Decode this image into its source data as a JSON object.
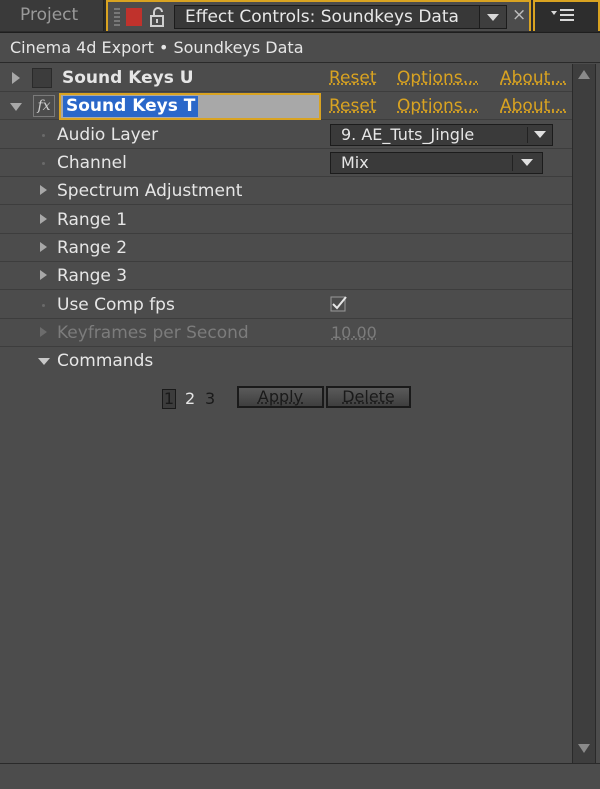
{
  "tabs": {
    "project_label": "Project",
    "active_title": "Effect Controls: Soundkeys Data",
    "close_glyph": "×"
  },
  "breadcrumb": "Cinema 4d Export • Soundkeys Data",
  "effects": [
    {
      "name": "Sound Keys  U",
      "expanded": false,
      "reset": "Reset",
      "options": "Options...",
      "about": "About..."
    },
    {
      "name": "Sound Keys T",
      "expanded": true,
      "editing": true,
      "reset": "Reset",
      "options": "Options...",
      "about": "About..."
    }
  ],
  "properties": {
    "audio_layer": {
      "label": "Audio Layer",
      "value": "9. AE_Tuts_Jingle"
    },
    "channel": {
      "label": "Channel",
      "value": "Mix"
    },
    "spectrum": {
      "label": "Spectrum Adjustment"
    },
    "range1": {
      "label": "Range 1"
    },
    "range2": {
      "label": "Range 2"
    },
    "range3": {
      "label": "Range 3"
    },
    "use_comp_fps": {
      "label": "Use Comp fps",
      "checked": true
    },
    "keyframes_per_second": {
      "label": "Keyframes per Second",
      "value": "10.00"
    },
    "commands": {
      "label": "Commands"
    }
  },
  "commands": {
    "pages": [
      "1",
      "2",
      "3"
    ],
    "selected_page": "1",
    "apply_label": "Apply",
    "delete_label": "Delete"
  },
  "icons": {
    "fx": "fx",
    "accent_color": "#d9a321",
    "label_color": "#e6e6e6"
  }
}
